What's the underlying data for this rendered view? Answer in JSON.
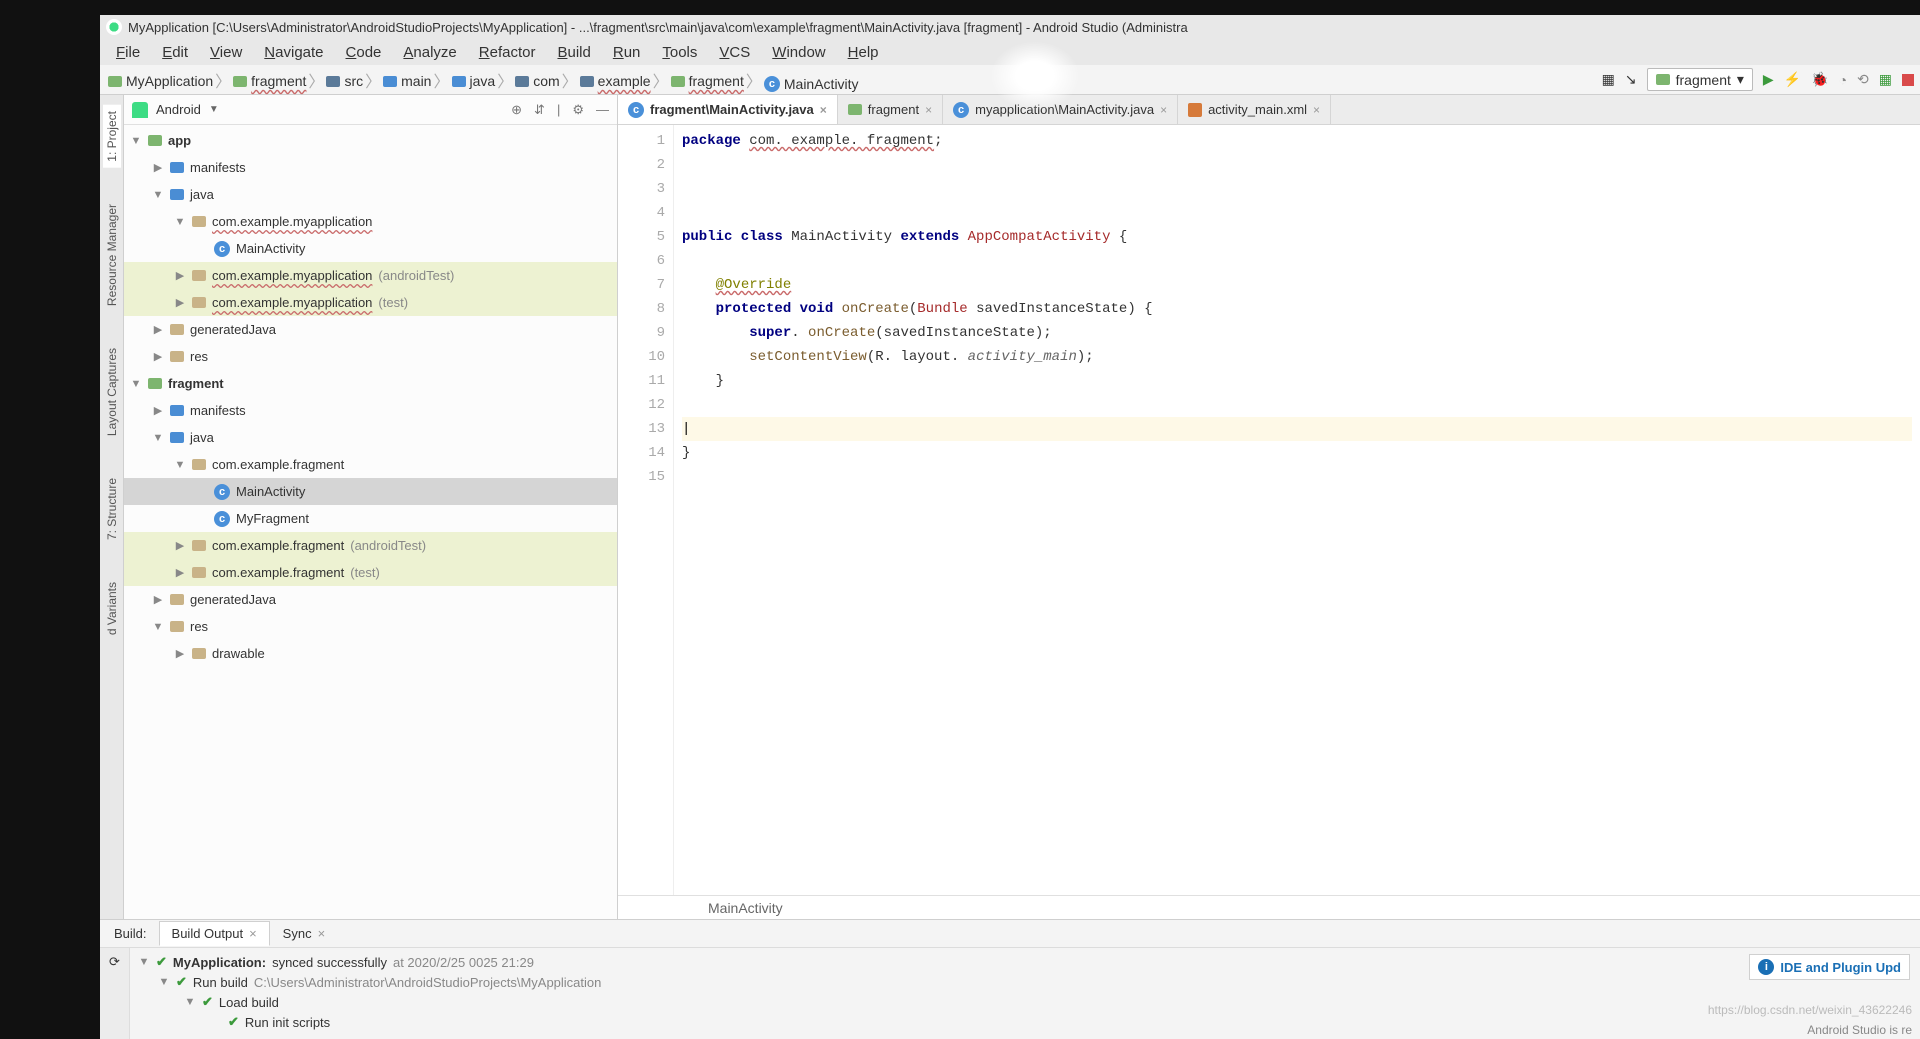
{
  "window": {
    "title": "MyApplication [C:\\Users\\Administrator\\AndroidStudioProjects\\MyApplication] - ...\\fragment\\src\\main\\java\\com\\example\\fragment\\MainActivity.java [fragment] - Android Studio (Administra"
  },
  "menu": [
    "File",
    "Edit",
    "View",
    "Navigate",
    "Code",
    "Analyze",
    "Refactor",
    "Build",
    "Run",
    "Tools",
    "VCS",
    "Window",
    "Help"
  ],
  "breadcrumbs": [
    {
      "icon": "folder-green",
      "label": "MyApplication"
    },
    {
      "icon": "folder-green",
      "label": "fragment"
    },
    {
      "icon": "src",
      "label": "src"
    },
    {
      "icon": "folder",
      "label": "main"
    },
    {
      "icon": "folder",
      "label": "java"
    },
    {
      "icon": "src",
      "label": "com"
    },
    {
      "icon": "src",
      "label": "example"
    },
    {
      "icon": "folder-green",
      "label": "fragment"
    },
    {
      "icon": "class",
      "label": "MainActivity"
    }
  ],
  "run_config": "fragment",
  "side_tabs": [
    "1: Project",
    "Resource Manager",
    "Layout Captures",
    "7: Structure",
    "d Variants"
  ],
  "project_panel": {
    "mode": "Android",
    "tree": [
      {
        "d": 0,
        "tw": "▼",
        "ico": "folder-green",
        "label": "app",
        "bold": true
      },
      {
        "d": 1,
        "tw": "▶",
        "ico": "folder",
        "label": "manifests"
      },
      {
        "d": 1,
        "tw": "▼",
        "ico": "folder",
        "label": "java"
      },
      {
        "d": 2,
        "tw": "▼",
        "ico": "folder-tan",
        "label": "com.example.myapplication",
        "sq": true
      },
      {
        "d": 3,
        "tw": "",
        "ico": "class",
        "label": "MainActivity"
      },
      {
        "d": 2,
        "tw": "▶",
        "ico": "folder-tan",
        "label": "com.example.myapplication",
        "suffix": " (androidTest)",
        "sq": true,
        "hl": true
      },
      {
        "d": 2,
        "tw": "▶",
        "ico": "folder-tan",
        "label": "com.example.myapplication",
        "suffix": " (test)",
        "sq": true,
        "hl": true
      },
      {
        "d": 1,
        "tw": "▶",
        "ico": "folder-tan",
        "label": "generatedJava"
      },
      {
        "d": 1,
        "tw": "▶",
        "ico": "folder-tan",
        "label": "res"
      },
      {
        "d": 0,
        "tw": "▼",
        "ico": "folder-green",
        "label": "fragment",
        "bold": true
      },
      {
        "d": 1,
        "tw": "▶",
        "ico": "folder",
        "label": "manifests"
      },
      {
        "d": 1,
        "tw": "▼",
        "ico": "folder",
        "label": "java"
      },
      {
        "d": 2,
        "tw": "▼",
        "ico": "folder-tan",
        "label": "com.example.fragment"
      },
      {
        "d": 3,
        "tw": "",
        "ico": "class",
        "label": "MainActivity",
        "sel": true
      },
      {
        "d": 3,
        "tw": "",
        "ico": "class",
        "label": "MyFragment"
      },
      {
        "d": 2,
        "tw": "▶",
        "ico": "folder-tan",
        "label": "com.example.fragment",
        "suffix": " (androidTest)",
        "hl": true
      },
      {
        "d": 2,
        "tw": "▶",
        "ico": "folder-tan",
        "label": "com.example.fragment",
        "suffix": " (test)",
        "hl": true
      },
      {
        "d": 1,
        "tw": "▶",
        "ico": "folder-tan",
        "label": "generatedJava"
      },
      {
        "d": 1,
        "tw": "▼",
        "ico": "folder-tan",
        "label": "res"
      },
      {
        "d": 2,
        "tw": "▶",
        "ico": "folder-tan",
        "label": "drawable"
      }
    ]
  },
  "editor_tabs": [
    {
      "ico": "class",
      "label": "fragment\\MainActivity.java",
      "active": true
    },
    {
      "ico": "folder-green",
      "label": "fragment"
    },
    {
      "ico": "class",
      "label": "myapplication\\MainActivity.java"
    },
    {
      "ico": "xml",
      "label": "activity_main.xml"
    }
  ],
  "code": {
    "lines": [
      {
        "n": 1,
        "segs": [
          {
            "t": "package ",
            "c": "kw"
          },
          {
            "t": "com. example. fragment",
            "c": "pkg-sq"
          },
          {
            "t": ";"
          }
        ]
      },
      {
        "n": 2,
        "segs": []
      },
      {
        "n": 3,
        "segs": []
      },
      {
        "n": 4,
        "segs": []
      },
      {
        "n": 5,
        "segs": [
          {
            "t": "public class ",
            "c": "kw"
          },
          {
            "t": "MainActivity "
          },
          {
            "t": "extends ",
            "c": "kw"
          },
          {
            "t": "AppCompatActivity ",
            "c": "cls"
          },
          {
            "t": "{"
          }
        ]
      },
      {
        "n": 6,
        "segs": []
      },
      {
        "n": 7,
        "segs": [
          {
            "t": "    "
          },
          {
            "t": "@Override",
            "c": "ann pkg-sq"
          }
        ]
      },
      {
        "n": 8,
        "segs": [
          {
            "t": "    "
          },
          {
            "t": "protected void ",
            "c": "kw"
          },
          {
            "t": "onCreate",
            "c": "fn"
          },
          {
            "t": "("
          },
          {
            "t": "Bundle",
            "c": "cls"
          },
          {
            "t": " savedInstanceState) {"
          }
        ]
      },
      {
        "n": 9,
        "segs": [
          {
            "t": "        "
          },
          {
            "t": "super",
            "c": "kw"
          },
          {
            "t": ". "
          },
          {
            "t": "onCreate",
            "c": "fn"
          },
          {
            "t": "(savedInstanceState);"
          }
        ]
      },
      {
        "n": 10,
        "segs": [
          {
            "t": "        "
          },
          {
            "t": "setContentView",
            "c": "fn"
          },
          {
            "t": "(R. layout. "
          },
          {
            "t": "activity_main",
            "c": "it"
          },
          {
            "t": ");"
          }
        ]
      },
      {
        "n": 11,
        "segs": [
          {
            "t": "    }"
          }
        ]
      },
      {
        "n": 12,
        "segs": []
      },
      {
        "n": 13,
        "segs": [],
        "hl": true,
        "caret": true
      },
      {
        "n": 14,
        "segs": [
          {
            "t": "}"
          }
        ]
      },
      {
        "n": 15,
        "segs": []
      }
    ]
  },
  "editor_crumb": "MainActivity",
  "build": {
    "label": "Build:",
    "tabs": [
      {
        "label": "Build Output",
        "active": true
      },
      {
        "label": "Sync"
      }
    ],
    "rows": [
      {
        "d": 0,
        "tw": "▼",
        "chk": true,
        "txt": [
          {
            "t": "MyApplication:",
            "b": true
          },
          {
            "t": " synced successfully "
          },
          {
            "t": "at 2020/2/25 0025 21:29",
            "g": true
          }
        ]
      },
      {
        "d": 1,
        "tw": "▼",
        "chk": true,
        "txt": [
          {
            "t": "Run build "
          },
          {
            "t": "C:\\Users\\Administrator\\AndroidStudioProjects\\MyApplication",
            "g": true
          }
        ]
      },
      {
        "d": 2,
        "tw": "▼",
        "chk": true,
        "txt": [
          {
            "t": "Load build"
          }
        ]
      },
      {
        "d": 3,
        "tw": "",
        "chk": true,
        "txt": [
          {
            "t": "Run init scripts"
          }
        ]
      }
    ]
  },
  "info_badge": "IDE and Plugin Upd",
  "watermark": "https://blog.csdn.net/weixin_43622246",
  "status_frag": "Android Studio is re"
}
